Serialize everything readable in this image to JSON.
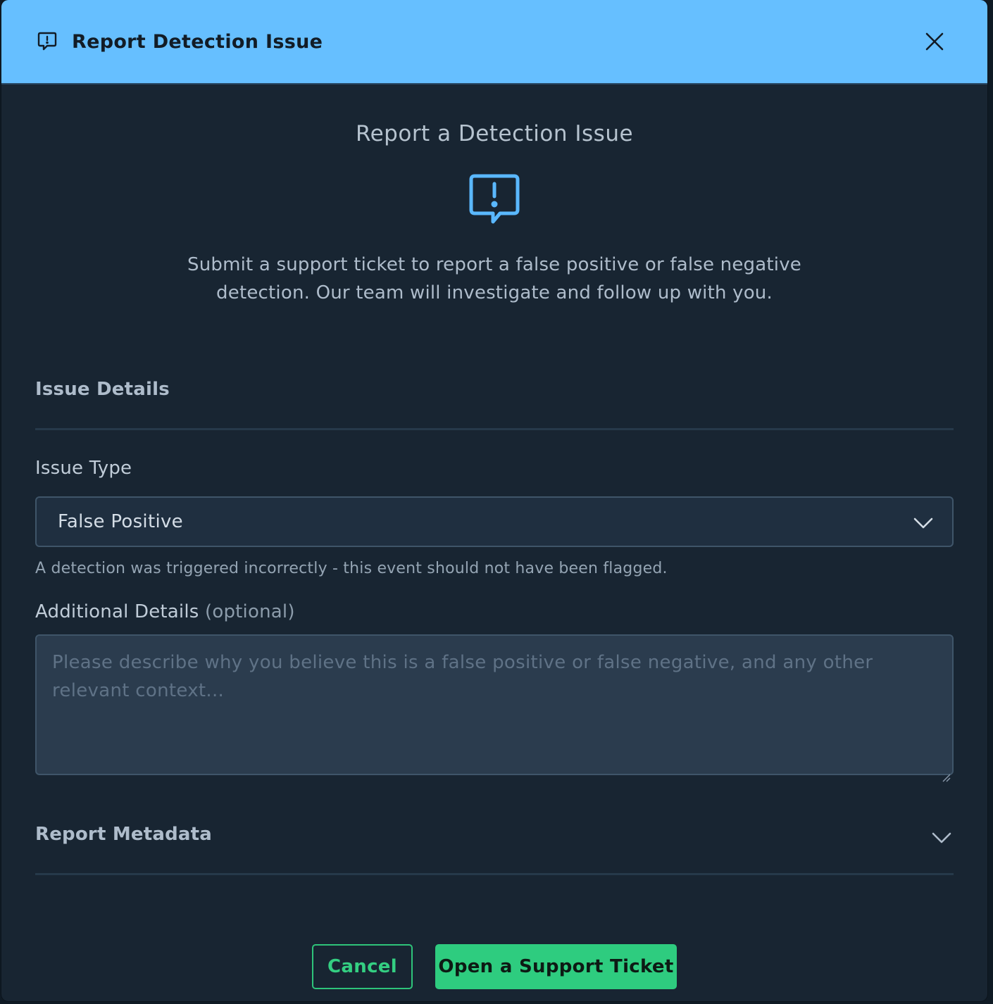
{
  "modal": {
    "title": "Report Detection Issue",
    "icon": "message-alert-icon",
    "close_icon": "close-icon"
  },
  "intro": {
    "title": "Report a Detection Issue",
    "icon": "message-alert-icon",
    "text": "Submit a support ticket to report a false positive or false negative detection. Our team will investigate and follow up with you."
  },
  "issue_details": {
    "heading": "Issue Details",
    "issue_type_label": "Issue Type",
    "issue_type_value": "False Positive",
    "issue_type_helper": "A detection was triggered incorrectly - this event should not have been flagged.",
    "additional_label": "Additional Details",
    "additional_optional": "(optional)",
    "additional_placeholder": "Please describe why you believe this is a false positive or false negative, and any other relevant context..."
  },
  "metadata": {
    "heading": "Report Metadata"
  },
  "actions": {
    "cancel_label": "Cancel",
    "submit_label": "Open a Support Ticket"
  },
  "colors": {
    "header_bg": "#66bfff",
    "body_bg": "#182532",
    "accent_green": "#2ecc7f",
    "icon_blue": "#5ab8ff"
  }
}
